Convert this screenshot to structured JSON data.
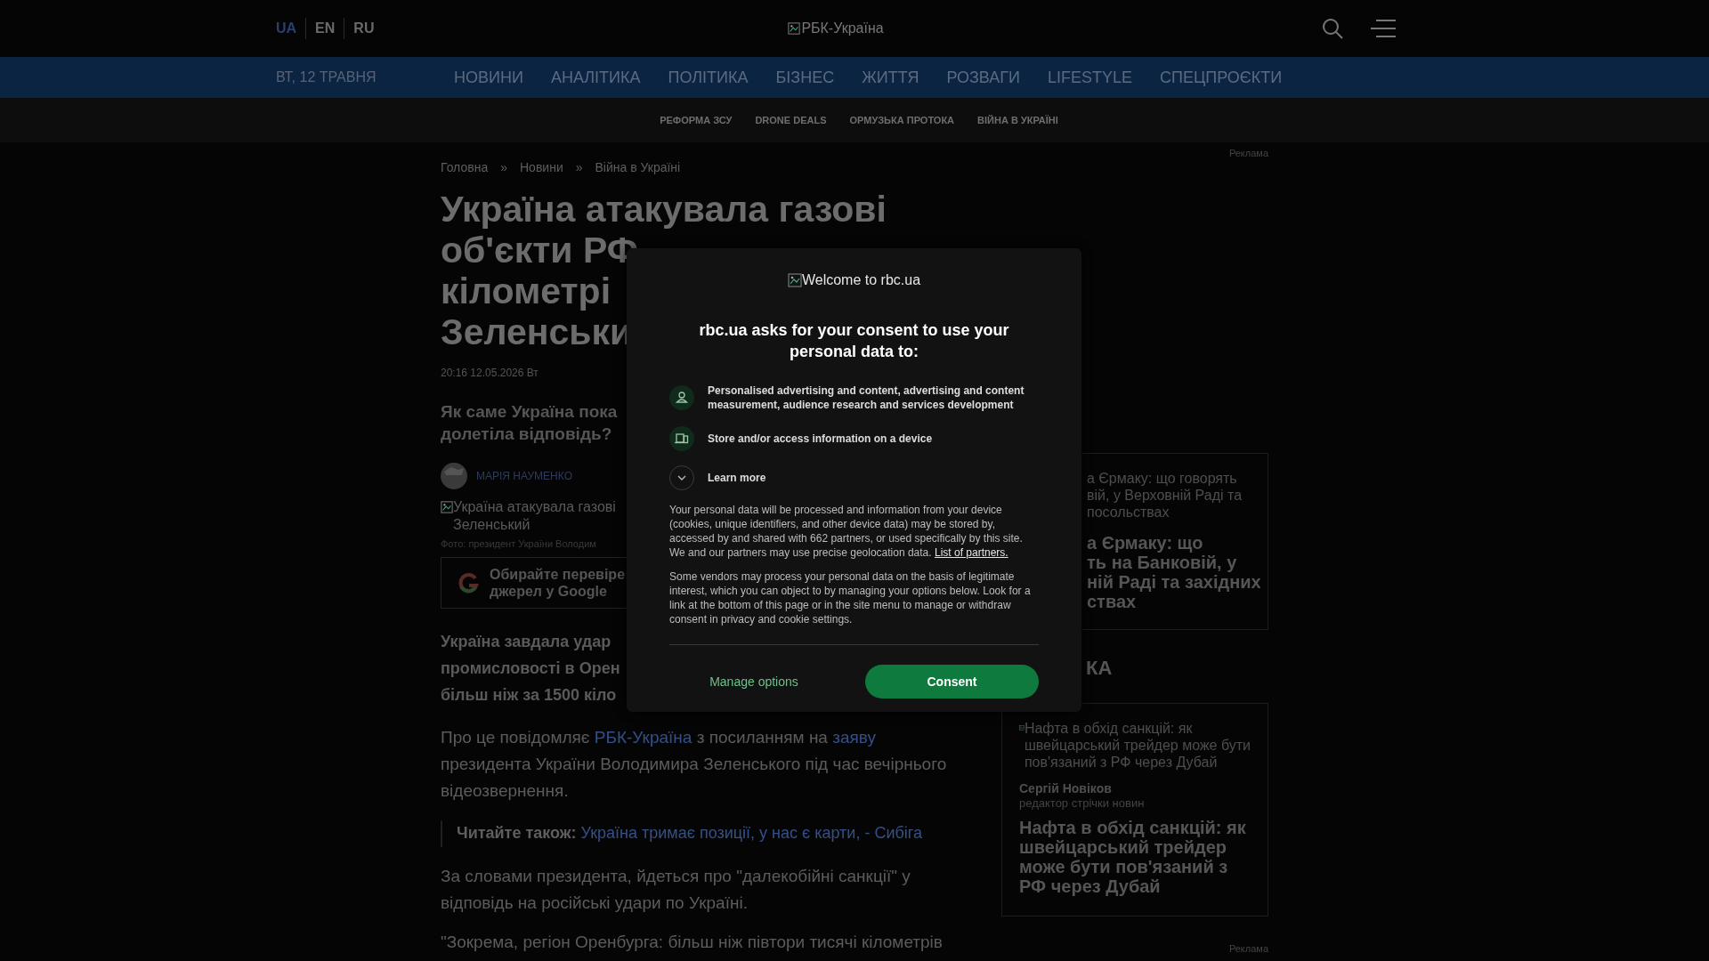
{
  "header": {
    "languages": [
      {
        "label": "UA",
        "selected": true
      },
      {
        "label": "EN",
        "selected": false
      },
      {
        "label": "RU",
        "selected": false
      }
    ],
    "logo_alt": "РБК-Україна"
  },
  "nav": {
    "date": "ВТ, 12 ТРАВНЯ",
    "items": [
      "НОВИНИ",
      "АНАЛІТИКА",
      "ПОЛІТИКА",
      "БІЗНЕС",
      "ЖИТТЯ",
      "РОЗВАГИ",
      "LIFESTYLE",
      "СПЕЦПРОЄКТИ"
    ]
  },
  "subnav": [
    "РЕФОРМА ЗСУ",
    "DRONE DEALS",
    "ОРМУЗЬКА ПРОТОКА",
    "ВІЙНА В УКРАЇНІ"
  ],
  "ad_labels": [
    "Реклама",
    "Реклама"
  ],
  "breadcrumbs": [
    "Головна",
    "Новини",
    "Війна в Україні"
  ],
  "breadcrumb_separator": "»",
  "article": {
    "headline_lines": [
      "Україна атакувала газові",
      "об'єкти РФ",
      "кілометрі",
      "Зеленськи"
    ],
    "datetime": "20:16 12.05.2026 Вт",
    "lede_lines": [
      "Як саме Україна пока",
      "долетіла відповідь?"
    ],
    "author": "МАРІЯ НАУМЕНКО",
    "image_alt_lines": [
      "Україна атакувала газові",
      "Зеленський"
    ],
    "photo_credit": "Фото: президент України Володим",
    "google_promo_lines": [
      "Обирайте перевіре",
      "джерел у Google"
    ],
    "lead_lines": [
      "Україна завдала удар",
      "промисловості в Орен",
      "більш ніж за 1500 кіло"
    ],
    "body": [
      {
        "kind": "paragraph",
        "segments": [
          {
            "text": "Про це повідомляє ",
            "link": false
          },
          {
            "text": "РБК-Україна",
            "link": true
          },
          {
            "text": " з посиланням на ",
            "link": false
          },
          {
            "text": "заяву",
            "link": true
          },
          {
            "text": " президента України Володимира Зеленського під час вечірнього відеозвернення.",
            "link": false
          }
        ]
      },
      {
        "kind": "read_also",
        "label": "Читайте також:",
        "link": "Україна тримає позиції, у нас є карти, - Сибіга"
      },
      {
        "kind": "paragraph",
        "segments": [
          {
            "text": "За словами президента, йдеться про \"далекобійні санкції\" у відповідь на російські удари по Україні.",
            "link": false
          }
        ]
      },
      {
        "kind": "paragraph",
        "segments": [
          {
            "text": "\"Зокрема, регіон Оренбурга: більш ніж півтори тисячі кілометрів",
            "link": false
          }
        ]
      }
    ]
  },
  "sidebar": {
    "card_1": {
      "image_alt_lines": [
        "а Єрмаку: що говорять",
        "вій, у Верховній Раді та",
        "посольствах"
      ],
      "title_lines": [
        "а Єрмаку: що",
        "ть на Банковій, у",
        "ній Раді та західних",
        "ствах"
      ]
    },
    "section_heading": "КА",
    "card_2": {
      "image_alt_lines": [
        "Нафта в обхід санкцій: як",
        "швейцарський трейдер може бути",
        "пов'язаний з РФ через Дубай"
      ],
      "author": "Сергій Новіков",
      "author_role": "редактор стрічки новин",
      "title_lines": [
        "Нафта в обхід санкцій: як",
        "швейцарський трейдер",
        "може бути пов'язаний з",
        "РФ через Дубай"
      ]
    }
  },
  "consent_modal": {
    "logo_alt": "Welcome to rbc.ua",
    "heading": "rbc.ua asks for your consent to use your personal data to:",
    "purposes": [
      {
        "kind": "person",
        "text": "Personalised advertising and content, advertising and content measurement, audience research and services development"
      },
      {
        "kind": "device",
        "text": "Store and/or access information on a device"
      }
    ],
    "learn_more": {
      "label": "Learn more",
      "expanded": false
    },
    "paragraphs": [
      [
        {
          "text": "Your personal data will be processed and information from your device (cookies, unique identifiers, and other device data) may be stored by, accessed by and shared with 662 partners, or used specifically by this site. We and our partners may use precise geolocation data. ",
          "link": false
        },
        {
          "text": "List of partners.",
          "link": true
        }
      ],
      [
        {
          "text": "Some vendors may process your personal data on the basis of legitimate interest, which you can object to by managing your options below. Look for a link at the bottom of this page or in the site menu to manage or withdraw consent in privacy and cookie settings.",
          "link": false
        }
      ]
    ],
    "buttons": [
      {
        "kind": "secondary",
        "label": "Manage options"
      },
      {
        "kind": "primary",
        "label": "Consent"
      }
    ]
  }
}
